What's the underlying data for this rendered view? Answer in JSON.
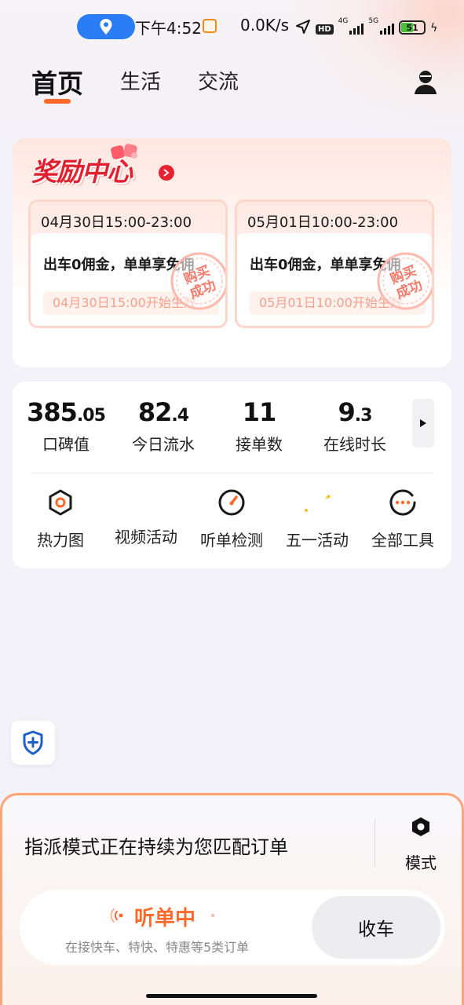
{
  "status_bar": {
    "time": "下午4:52",
    "net_speed": "0.0K/s",
    "hd": "HD",
    "net1": "4G",
    "net2": "5G",
    "battery": "51",
    "colors": {
      "location_pill": "#2a7df5",
      "battery_fill": "#45c23a"
    },
    "icons": [
      "location-icon",
      "app-notification-icon",
      "navigation-arrow-icon",
      "signal-icon",
      "battery-icon",
      "charging-icon"
    ]
  },
  "nav": {
    "tabs": [
      {
        "label": "首页",
        "active": true
      },
      {
        "label": "生活",
        "active": false
      },
      {
        "label": "交流",
        "active": false
      }
    ],
    "accent": "#ff6a2c"
  },
  "reward": {
    "title": "奖励中心",
    "coupons": [
      {
        "time": "04月30日15:00-23:00",
        "desc": "出车0佣金，单单享免佣",
        "start": "04月30日15:00开始生效",
        "stamp": "购买成功"
      },
      {
        "time": "05月01日10:00-23:00",
        "desc": "出车0佣金，单单享免佣",
        "start": "05月01日10:00开始生效",
        "stamp": "购买成功"
      }
    ]
  },
  "stats": [
    {
      "int": "385",
      "dec": ".05",
      "label": "口碑值"
    },
    {
      "int": "82",
      "dec": ".4",
      "label": "今日流水"
    },
    {
      "int": "11",
      "dec": "",
      "label": "接单数"
    },
    {
      "int": "9",
      "dec": ".3",
      "label": "在线时长"
    }
  ],
  "tools": [
    {
      "label": "热力图",
      "icon": "heatmap-icon"
    },
    {
      "label": "视频活动",
      "icon": "video-icon"
    },
    {
      "label": "听单检测",
      "icon": "gauge-icon"
    },
    {
      "label": "五一活动",
      "icon": "sparkle-icon"
    },
    {
      "label": "全部工具",
      "icon": "more-tools-icon"
    }
  ],
  "dispatch": {
    "text": "指派模式正在持续为您匹配订单",
    "mode_label": "模式"
  },
  "listen": {
    "status": "听单中",
    "sub": "在接快车、特快、特惠等5类订单",
    "stop_label": "收车"
  }
}
